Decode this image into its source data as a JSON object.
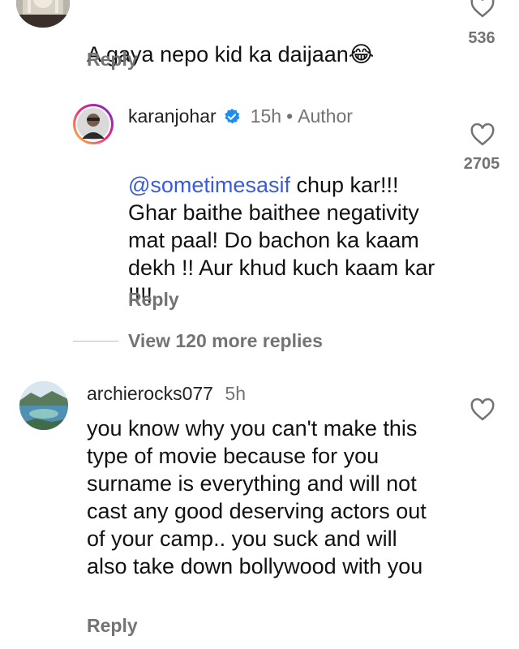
{
  "comments": [
    {
      "text": "A gaya nepo kid ka daijaan",
      "emoji": "😂",
      "reply_label": "Reply",
      "like_count": "536",
      "like_icon": "heart-outline-icon"
    },
    {
      "username": "karanjohar",
      "verified_icon": "verified-badge-icon",
      "time": "15h",
      "separator": "•",
      "author_label": "Author",
      "mention": "@sometimesasif",
      "text": " chup kar!!! Ghar baithe baithee negativity mat paal! Do bachon ka kaam dekh !! Aur khud kuch kaam kar !!!!",
      "reply_label": "Reply",
      "like_count": "2705",
      "like_icon": "heart-outline-icon",
      "view_replies": "View 120 more replies"
    },
    {
      "username": "archierocks077",
      "time": "5h",
      "text": "you know why you can't make this type of movie because for you surname is everything and will not cast any good deserving actors out of your camp.. you suck and will also take down bollywood with you",
      "reply_label": "Reply",
      "like_icon": "heart-outline-icon"
    }
  ],
  "colors": {
    "text": "#111111",
    "secondary": "#737373",
    "mention": "#3b5bdb",
    "verified": "#1d8cf0",
    "story_ring_start": "#f9ce34",
    "story_ring_end": "#ee2a7b"
  }
}
